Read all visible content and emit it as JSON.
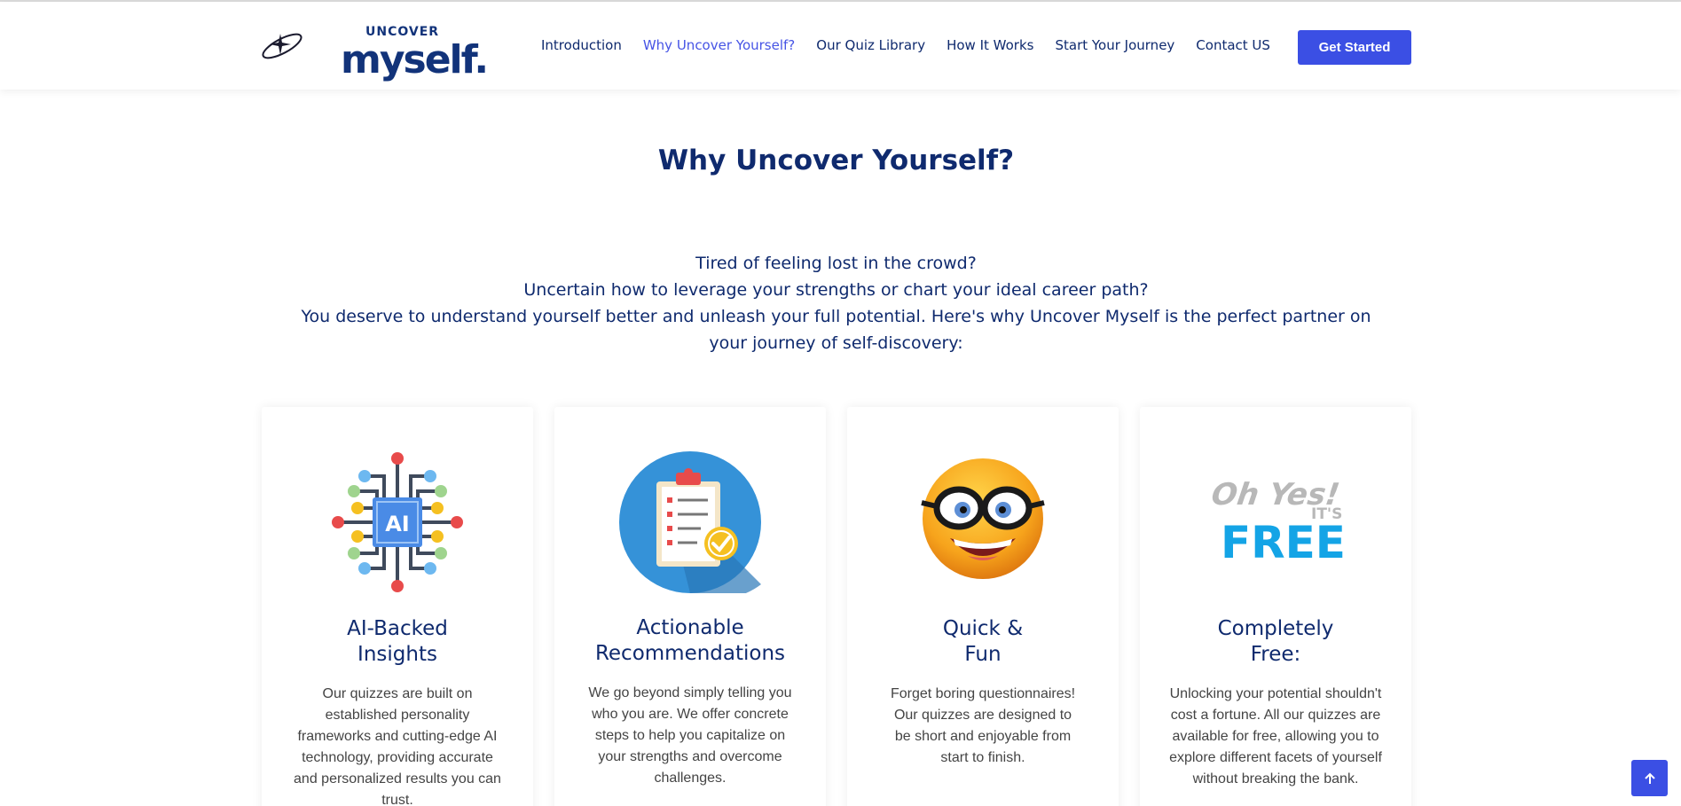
{
  "brand": {
    "logo_small": "UNCOVER",
    "logo_big": "myself."
  },
  "nav": {
    "items": [
      {
        "label": "Introduction"
      },
      {
        "label": "Why Uncover Yourself?"
      },
      {
        "label": "Our Quiz Library"
      },
      {
        "label": "How It Works"
      },
      {
        "label": "Start Your Journey"
      },
      {
        "label": "Contact US"
      }
    ],
    "active_index": 1,
    "cta_label": "Get Started"
  },
  "section": {
    "title": "Why Uncover Yourself?",
    "intro_lines": [
      "Tired of feeling lost in the crowd?",
      "Uncertain how to leverage your strengths or chart your ideal career path?",
      "You deserve to understand yourself better and unleash your full potential. Here's why Uncover Myself is the perfect partner on your journey of self-discovery:"
    ]
  },
  "cards": [
    {
      "title_line1": "AI-Backed",
      "title_line2": "Insights",
      "body": "Our quizzes are built on established personality frameworks and cutting-edge AI technology, providing accurate and personalized results you can trust.",
      "image_text": "AI"
    },
    {
      "title_line1": "Actionable",
      "title_line2": "Recommendations",
      "body": "We go beyond simply telling you who you are. We offer concrete steps to help you capitalize on your strengths and overcome challenges."
    },
    {
      "title_line1": "Quick &",
      "title_line2": "Fun",
      "body": "Forget boring questionnaires! Our quizzes are designed to be short and enjoyable from start to finish."
    },
    {
      "title_line1": "Completely",
      "title_line2": "Free:",
      "body": "Unlocking your potential shouldn't cost a fortune. All our quizzes are available for free, allowing you to explore different facets of yourself without breaking the bank.",
      "image_text_1": "Oh Yes!",
      "image_text_2": "IT'S",
      "image_text_3": "FREE"
    }
  ],
  "colors": {
    "primary": "#3b4fe4",
    "heading": "#0f2a6e",
    "active_nav": "#4654e5",
    "body_text": "#444444"
  },
  "icons": {
    "scroll_top": "arrow-up-icon",
    "card_images": [
      "ai-chip-icon",
      "clipboard-checklist-icon",
      "smiley-glasses-icon",
      "free-text-icon"
    ]
  }
}
